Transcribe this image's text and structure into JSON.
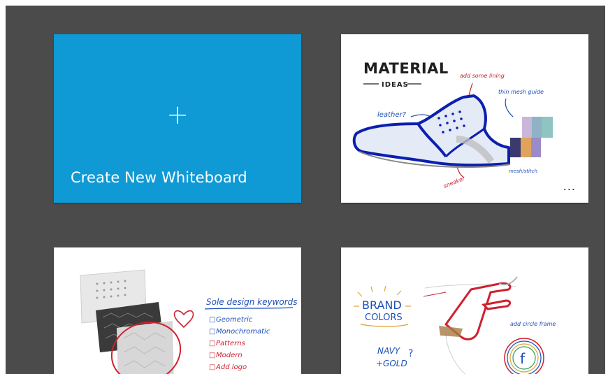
{
  "create_tile": {
    "plus_glyph": "+",
    "label": "Create New Whiteboard",
    "color": "#0f9ad5"
  },
  "whiteboards": [
    {
      "id": "material",
      "title_main": "MATERIAL",
      "title_sub": "IDEAS",
      "notes": [
        "add some lining",
        "thin mesh guide",
        "leather?",
        "sneaker",
        "mesh/stitch"
      ],
      "swatch_colors": [
        "#c9b6d9",
        "#8fb3c4",
        "#8ec4c2",
        "#3b3a6e",
        "#e0a35c",
        "#9a8cc9"
      ],
      "more_label": "..."
    },
    {
      "id": "sole",
      "heading": "Sole design keywords",
      "keywords": [
        "Geometric",
        "Monochromatic",
        "Patterns",
        "Modern",
        "Add logo"
      ]
    },
    {
      "id": "brand",
      "title_line1": "BRAND",
      "title_line2": "COLORS",
      "sub_line1": "NAVY",
      "sub_line2": "+GOLD",
      "sub_mark": "?",
      "note": "add circle frame",
      "logo_letter": "f"
    }
  ]
}
